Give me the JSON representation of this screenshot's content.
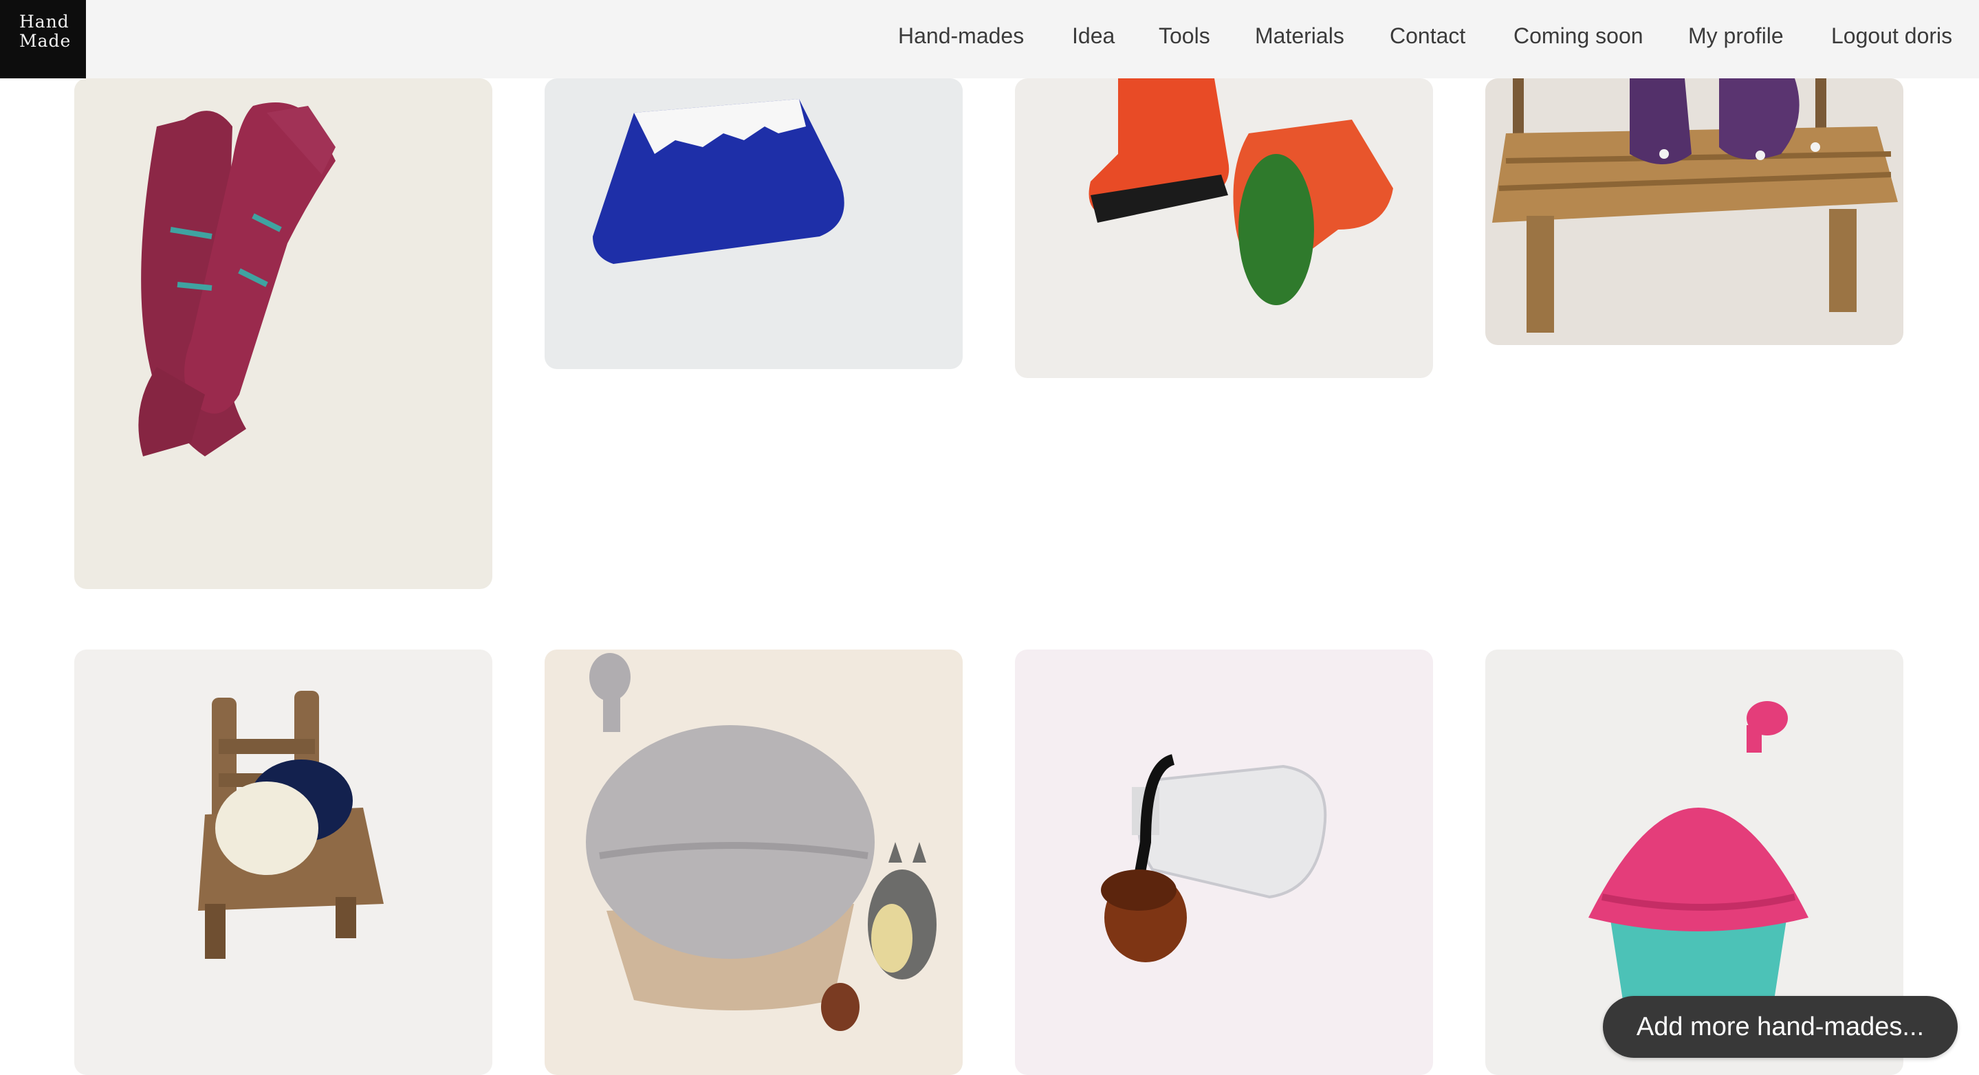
{
  "brand": {
    "line1": "Hand",
    "line2": "Made"
  },
  "nav": [
    "Hand-mades",
    "Idea",
    "Tools",
    "Materials",
    "Contact",
    "Coming soon",
    "My profile",
    "Logout doris"
  ],
  "gallery": {
    "photos": [
      "knitted-socks-photo",
      "crochet-fuji-pouch-photo",
      "crochet-red-boots-photo",
      "crochet-purple-slippers-on-bench-photo",
      "crochet-acorn-on-chair-photo",
      "crochet-cupcake-with-totoro-photo",
      "crochet-acorn-with-bottle-photo",
      "crochet-pink-cupcake-photo"
    ]
  },
  "fab": {
    "label": "Add more hand-mades..."
  }
}
